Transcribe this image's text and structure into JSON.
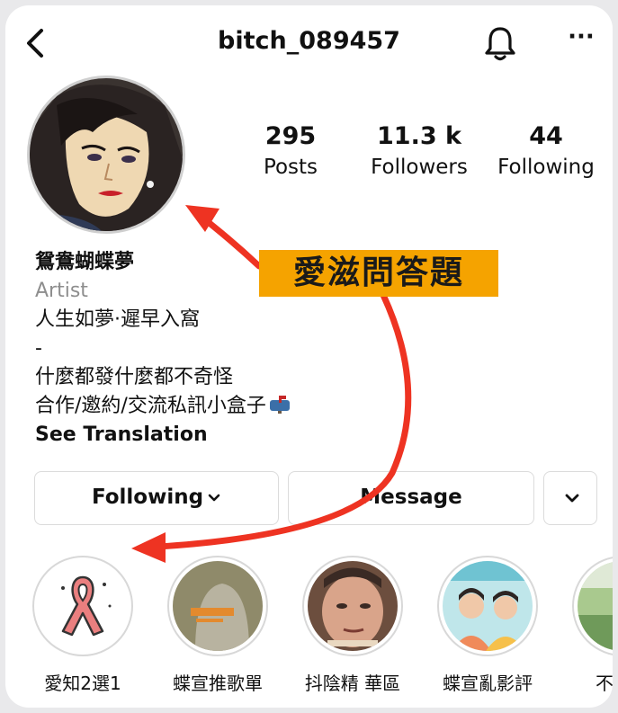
{
  "header": {
    "username": "bitch_089457",
    "back_icon": "chevron-left-icon",
    "bell_icon": "bell-icon",
    "more_label": "···"
  },
  "stats": [
    {
      "value": "295",
      "label": "Posts"
    },
    {
      "value": "11.3 k",
      "label": "Followers"
    },
    {
      "value": "44",
      "label": "Following"
    }
  ],
  "bio": {
    "name": "鴛鴦蝴蝶夢",
    "category": "Artist",
    "lines": [
      "人生如夢·遲早入窩",
      "-",
      "什麼都發什麼都不奇怪",
      "合作/邀約/交流私訊小盒子"
    ],
    "see_translation": "See Translation"
  },
  "buttons": {
    "following": "Following",
    "message": "Message"
  },
  "highlights": [
    {
      "label": "愛知2選1"
    },
    {
      "label": "蝶宣推歌單"
    },
    {
      "label": "抖陰精 華區"
    },
    {
      "label": "蝶宣亂影評"
    },
    {
      "label": "不要走"
    }
  ],
  "annotation": {
    "banner": "愛滋問答題",
    "color": "#f5a300",
    "arrow_color": "#ee3322"
  }
}
